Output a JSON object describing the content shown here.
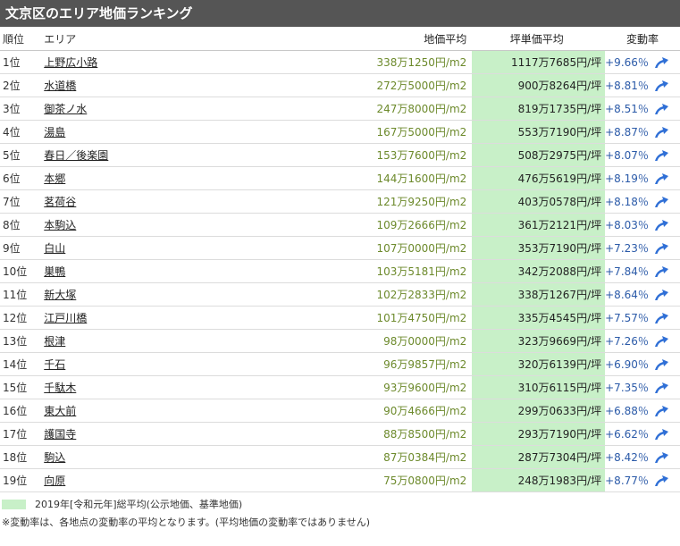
{
  "title": "文京区のエリア地価ランキング",
  "headers": {
    "rank": "順位",
    "area": "エリア",
    "land_price": "地価平均",
    "tsubo_price": "坪単価平均",
    "change_rate": "変動率"
  },
  "colors": {
    "header_bg": "#555555",
    "tsubo_bg": "#c8f0c8",
    "land_price_text": "#6d8a2c",
    "rate_text": "#2b5aa8",
    "arrow": "#2f6fd6"
  },
  "rows": [
    {
      "rank": "1位",
      "area": "上野広小路",
      "land": "338万1250円/m2",
      "tsubo": "1117万7685円/坪",
      "rate": "+9.66％"
    },
    {
      "rank": "2位",
      "area": "水道橋",
      "land": "272万5000円/m2",
      "tsubo": "900万8264円/坪",
      "rate": "+8.81％"
    },
    {
      "rank": "3位",
      "area": "御茶ノ水",
      "land": "247万8000円/m2",
      "tsubo": "819万1735円/坪",
      "rate": "+8.51％"
    },
    {
      "rank": "4位",
      "area": "湯島",
      "land": "167万5000円/m2",
      "tsubo": "553万7190円/坪",
      "rate": "+8.87％"
    },
    {
      "rank": "5位",
      "area": "春日／後楽園",
      "land": "153万7600円/m2",
      "tsubo": "508万2975円/坪",
      "rate": "+8.07％"
    },
    {
      "rank": "6位",
      "area": "本郷",
      "land": "144万1600円/m2",
      "tsubo": "476万5619円/坪",
      "rate": "+8.19％"
    },
    {
      "rank": "7位",
      "area": "茗荷谷",
      "land": "121万9250円/m2",
      "tsubo": "403万0578円/坪",
      "rate": "+8.18％"
    },
    {
      "rank": "8位",
      "area": "本駒込",
      "land": "109万2666円/m2",
      "tsubo": "361万2121円/坪",
      "rate": "+8.03％"
    },
    {
      "rank": "9位",
      "area": "白山",
      "land": "107万0000円/m2",
      "tsubo": "353万7190円/坪",
      "rate": "+7.23％"
    },
    {
      "rank": "10位",
      "area": "巣鴨",
      "land": "103万5181円/m2",
      "tsubo": "342万2088円/坪",
      "rate": "+7.84％"
    },
    {
      "rank": "11位",
      "area": "新大塚",
      "land": "102万2833円/m2",
      "tsubo": "338万1267円/坪",
      "rate": "+8.64％"
    },
    {
      "rank": "12位",
      "area": "江戸川橋",
      "land": "101万4750円/m2",
      "tsubo": "335万4545円/坪",
      "rate": "+7.57％"
    },
    {
      "rank": "13位",
      "area": "根津",
      "land": "98万0000円/m2",
      "tsubo": "323万9669円/坪",
      "rate": "+7.26％"
    },
    {
      "rank": "14位",
      "area": "千石",
      "land": "96万9857円/m2",
      "tsubo": "320万6139円/坪",
      "rate": "+6.90％"
    },
    {
      "rank": "15位",
      "area": "千駄木",
      "land": "93万9600円/m2",
      "tsubo": "310万6115円/坪",
      "rate": "+7.35％"
    },
    {
      "rank": "16位",
      "area": "東大前",
      "land": "90万4666円/m2",
      "tsubo": "299万0633円/坪",
      "rate": "+6.88％"
    },
    {
      "rank": "17位",
      "area": "護国寺",
      "land": "88万8500円/m2",
      "tsubo": "293万7190円/坪",
      "rate": "+6.62％"
    },
    {
      "rank": "18位",
      "area": "駒込",
      "land": "87万0384円/m2",
      "tsubo": "287万7304円/坪",
      "rate": "+8.42％"
    },
    {
      "rank": "19位",
      "area": "向原",
      "land": "75万0800円/m2",
      "tsubo": "248万1983円/坪",
      "rate": "+8.77％"
    }
  ],
  "legend_text": "2019年[令和元年]総平均(公示地価、基準地価)",
  "footnote": "※変動率は、各地点の変動率の平均となります。(平均地価の変動率ではありません)"
}
